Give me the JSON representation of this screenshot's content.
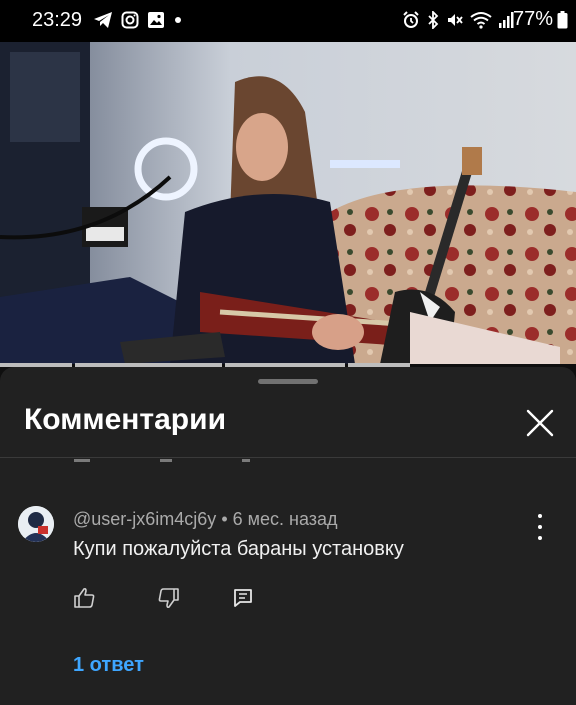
{
  "status_bar": {
    "time": "23:29",
    "battery": "77%",
    "left_icons": [
      "telegram-icon",
      "instagram-icon",
      "gallery-icon",
      "dot-icon"
    ],
    "right_icons": [
      "alarm-icon",
      "bluetooth-icon",
      "mute-icon",
      "wifi-icon",
      "signal-icon",
      "battery-icon"
    ]
  },
  "video": {
    "icon": "video-player"
  },
  "sheet": {
    "title": "Комментарии",
    "close_icon": "close-icon"
  },
  "comment": {
    "author": "@user-jx6im4cj6y",
    "separator": " • ",
    "time_ago": "6 мес. назад",
    "text": "Купи пожалуйста бараны установку",
    "like_icon": "thumb-up-icon",
    "dislike_icon": "thumb-down-icon",
    "reply_icon": "reply-icon",
    "more_icon": "more-vert-icon",
    "replies_label": "1 ответ"
  },
  "colors": {
    "sheet_bg": "#212121",
    "accent_link": "#3ea6ff",
    "meta_text": "#aaaaaa"
  }
}
